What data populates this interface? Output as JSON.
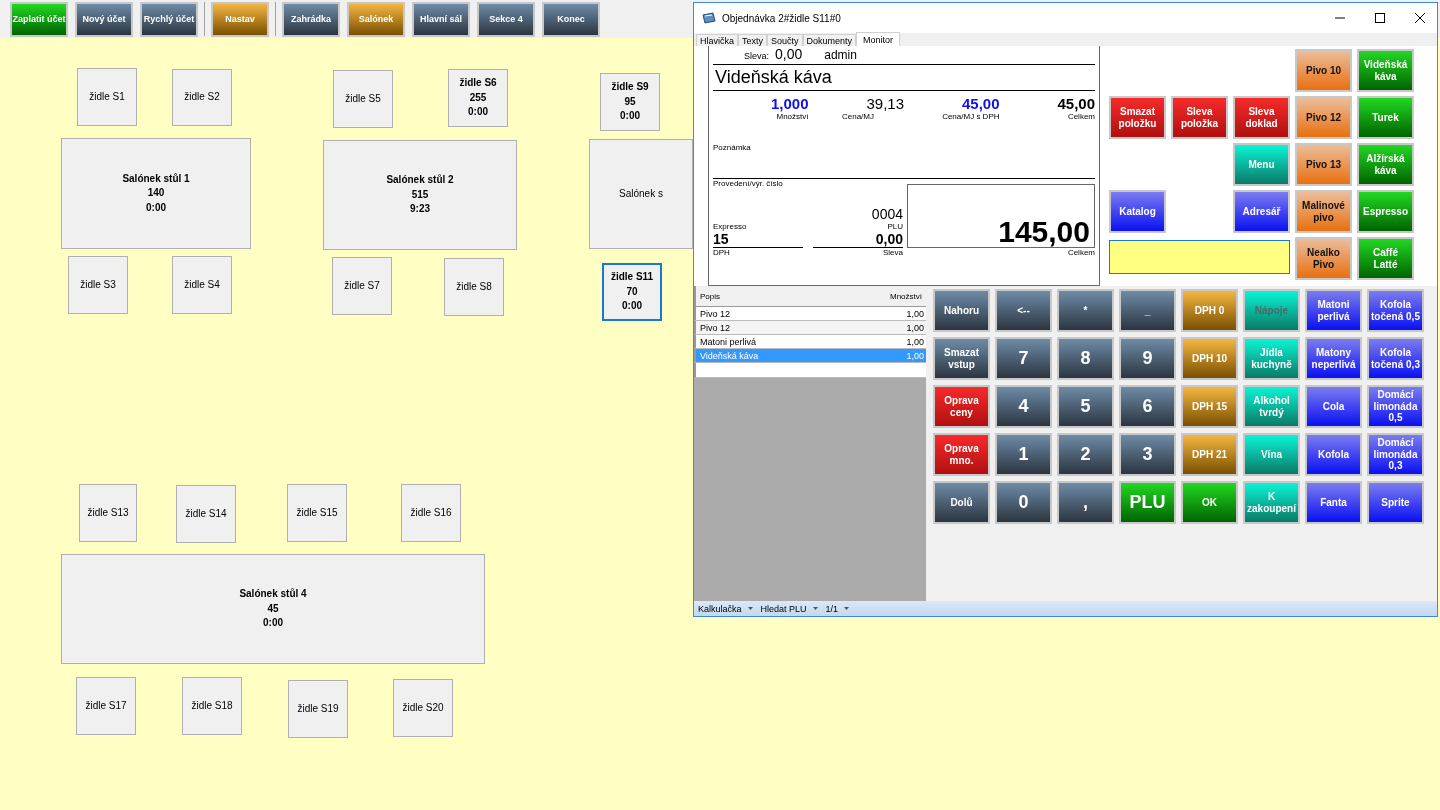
{
  "toolbar": {
    "groups": [
      [
        {
          "label": "Zaplatit účet",
          "kind": "green"
        },
        {
          "label": "Nový účet",
          "kind": "slate"
        },
        {
          "label": "Rychlý účet",
          "kind": "slate"
        }
      ],
      [
        {
          "label": "Nastav",
          "kind": "orange"
        }
      ],
      [
        {
          "label": "Zahrádka",
          "kind": "slate"
        },
        {
          "label": "Salónek",
          "kind": "orange"
        },
        {
          "label": "Hlavní sál",
          "kind": "slate"
        },
        {
          "label": "Sekce 4",
          "kind": "slate"
        },
        {
          "label": "Konec",
          "kind": "slate"
        }
      ]
    ]
  },
  "floor_plan": {
    "items": [
      {
        "name": "židle S1",
        "occupied": false,
        "selected": false
      },
      {
        "name": "židle S2",
        "occupied": false,
        "selected": false
      },
      {
        "name": "židle S5",
        "occupied": false,
        "selected": false
      },
      {
        "name": "židle S6",
        "amount": "255",
        "time": "0:00",
        "occupied": true,
        "selected": false
      },
      {
        "name": "židle S9",
        "amount": "95",
        "time": "0:00",
        "occupied": true,
        "selected": false
      },
      {
        "name": "Salónek stůl 1",
        "amount": "140",
        "time": "0:00",
        "occupied": true,
        "selected": false
      },
      {
        "name": "Salónek stůl 2",
        "amount": "515",
        "time": "9:23",
        "occupied": true,
        "selected": false
      },
      {
        "name": "Salónek s",
        "occupied": false,
        "selected": false
      },
      {
        "name": "židle S3",
        "occupied": false,
        "selected": false
      },
      {
        "name": "židle S4",
        "occupied": false,
        "selected": false
      },
      {
        "name": "židle S7",
        "occupied": false,
        "selected": false
      },
      {
        "name": "židle S8",
        "occupied": false,
        "selected": false
      },
      {
        "name": "židle S11",
        "amount": "70",
        "time": "0:00",
        "occupied": true,
        "selected": true
      },
      {
        "name": "židle S13",
        "occupied": false,
        "selected": false
      },
      {
        "name": "židle S14",
        "occupied": false,
        "selected": false
      },
      {
        "name": "židle S15",
        "occupied": false,
        "selected": false
      },
      {
        "name": "židle S16",
        "occupied": false,
        "selected": false
      },
      {
        "name": "Salónek stůl 4",
        "amount": "45",
        "time": "0:00",
        "occupied": true,
        "selected": false
      },
      {
        "name": "židle S17",
        "occupied": false,
        "selected": false
      },
      {
        "name": "židle S18",
        "occupied": false,
        "selected": false
      },
      {
        "name": "židle S19",
        "occupied": false,
        "selected": false
      },
      {
        "name": "židle S20",
        "occupied": false,
        "selected": false
      }
    ]
  },
  "window": {
    "title": "Objednávka 2#židle S11#0",
    "tabs": [
      {
        "label": "Hlavička",
        "selected": false
      },
      {
        "label": "Texty",
        "selected": false
      },
      {
        "label": "Součty",
        "selected": false
      },
      {
        "label": "Dokumenty",
        "selected": false
      },
      {
        "label": "Monitor",
        "selected": true
      }
    ],
    "monitor": {
      "discount_label": "Sleva:",
      "discount": "0,00",
      "user": "admin",
      "product": "Videňská káva",
      "values": [
        {
          "value": "1,000",
          "caption": "Množství",
          "highlight": true
        },
        {
          "value": "39,13",
          "caption": "Cena/MJ",
          "highlight": false
        },
        {
          "value": "45,00",
          "caption": "Cena/MJ s DPH",
          "highlight": true
        },
        {
          "value": "45,00",
          "caption": "Celkem",
          "highlight": false
        }
      ],
      "note_label": "Poznámka",
      "batch_label": "Provedení/výr. číslo",
      "plu": "0004",
      "plu_caption": "PLU",
      "item_name": "Expresso",
      "vat": "15",
      "vat_caption": "DPH",
      "discount2": "0,00",
      "discount2_caption": "Sleva",
      "total": "145,00",
      "total_caption": "Celkem"
    },
    "quick_buttons": [
      {
        "label": "Pivo 10",
        "kind": "peach"
      },
      {
        "label": "Videňská káva",
        "kind": "green"
      },
      {
        "label": "Smazat položku",
        "kind": "red"
      },
      {
        "label": "Sleva položka",
        "kind": "red"
      },
      {
        "label": "Sleva doklad",
        "kind": "red"
      },
      {
        "label": "Pivo 12",
        "kind": "peach"
      },
      {
        "label": "Turek",
        "kind": "green"
      },
      {
        "label": "Menu",
        "kind": "teal"
      },
      {
        "label": "Pivo 13",
        "kind": "peach"
      },
      {
        "label": "Alžírská káva",
        "kind": "green"
      },
      {
        "label": "Katalog",
        "kind": "blue"
      },
      {
        "label": "Adresář",
        "kind": "blue"
      },
      {
        "label": "Malinové pivo",
        "kind": "peach"
      },
      {
        "label": "Espresso",
        "kind": "green"
      }
    ],
    "entry_field": {
      "focused": true
    },
    "bottom_buttons": [
      {
        "label": "Nealko Pivo",
        "kind": "peach"
      },
      {
        "label": "Caffé Latté",
        "kind": "green"
      }
    ],
    "order_list": {
      "columns": [
        "Popis",
        "Množství"
      ],
      "rows": [
        {
          "name": "Pivo 12",
          "quantity": "1,00",
          "selected": false
        },
        {
          "name": "Pivo 12",
          "quantity": "1,00",
          "selected": false
        },
        {
          "name": "Matoni perlivá",
          "quantity": "1,00",
          "selected": false
        },
        {
          "name": "Videňská káva",
          "quantity": "1,00",
          "selected": true
        }
      ]
    },
    "keypad": [
      [
        {
          "label": "Nahoru",
          "kind": "slate",
          "disabled": false
        },
        {
          "label": "<--",
          "kind": "slate",
          "disabled": false
        },
        {
          "label": "*",
          "kind": "slate",
          "disabled": false
        },
        {
          "label": "_",
          "kind": "slate",
          "disabled": false
        },
        {
          "label": "DPH 0",
          "kind": "orange",
          "disabled": false
        },
        {
          "label": "Nápoje",
          "kind": "teal",
          "disabled": true
        },
        {
          "label": "Matoni perlivá",
          "kind": "blue",
          "disabled": false
        },
        {
          "label": "Kofola točená 0,5",
          "kind": "blue",
          "disabled": false
        }
      ],
      [
        {
          "label": "Smazat vstup",
          "kind": "slate",
          "disabled": false
        },
        {
          "label": "7",
          "kind": "digit",
          "disabled": false
        },
        {
          "label": "8",
          "kind": "digit",
          "disabled": false
        },
        {
          "label": "9",
          "kind": "digit",
          "disabled": false
        },
        {
          "label": "DPH 10",
          "kind": "orange",
          "disabled": false
        },
        {
          "label": "Jídla kuchyně",
          "kind": "teal",
          "disabled": false
        },
        {
          "label": "Matony neperlivá",
          "kind": "blue",
          "disabled": false
        },
        {
          "label": "Kofola točená 0,3",
          "kind": "blue",
          "disabled": false
        }
      ],
      [
        {
          "label": "Oprava ceny",
          "kind": "red",
          "disabled": false
        },
        {
          "label": "4",
          "kind": "digit",
          "disabled": false
        },
        {
          "label": "5",
          "kind": "digit",
          "disabled": false
        },
        {
          "label": "6",
          "kind": "digit",
          "disabled": false
        },
        {
          "label": "DPH 15",
          "kind": "orange",
          "disabled": false
        },
        {
          "label": "Alkohol tvrdý",
          "kind": "teal",
          "disabled": false
        },
        {
          "label": "Cola",
          "kind": "blue",
          "disabled": false
        },
        {
          "label": "Domácí limonáda 0,5",
          "kind": "blue",
          "disabled": false
        }
      ],
      [
        {
          "label": "Oprava mno.",
          "kind": "red",
          "disabled": false
        },
        {
          "label": "1",
          "kind": "digit",
          "disabled": false
        },
        {
          "label": "2",
          "kind": "digit",
          "disabled": false
        },
        {
          "label": "3",
          "kind": "digit",
          "disabled": false
        },
        {
          "label": "DPH 21",
          "kind": "orange",
          "disabled": false
        },
        {
          "label": "Vína",
          "kind": "teal",
          "disabled": false
        },
        {
          "label": "Kofola",
          "kind": "blue",
          "disabled": false
        },
        {
          "label": "Domácí limonáda 0,3",
          "kind": "blue",
          "disabled": false
        }
      ],
      [
        {
          "label": "Dolů",
          "kind": "slate",
          "disabled": false
        },
        {
          "label": "0",
          "kind": "digit",
          "disabled": false
        },
        {
          "label": ",",
          "kind": "digit",
          "disabled": false
        },
        {
          "label": "PLU",
          "kind": "bigGreen",
          "disabled": false
        },
        {
          "label": "OK",
          "kind": "green",
          "disabled": false
        },
        {
          "label": "K zakoupení",
          "kind": "teal",
          "disabled": false
        },
        {
          "label": "Fanta",
          "kind": "blue",
          "disabled": false
        },
        {
          "label": "Sprite",
          "kind": "blue",
          "disabled": false
        }
      ]
    ],
    "status_bar": [
      "Kalkulačka",
      "Hledat PLU",
      "1/1"
    ]
  }
}
